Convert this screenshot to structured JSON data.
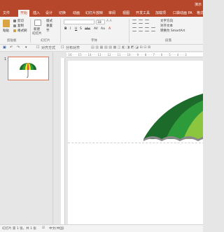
{
  "titlebar": {
    "title": "演示"
  },
  "tabs": [
    {
      "label": "文件"
    },
    {
      "label": "开始"
    },
    {
      "label": "插入"
    },
    {
      "label": "设计"
    },
    {
      "label": "切换"
    },
    {
      "label": "动画"
    },
    {
      "label": "幻灯片放映"
    },
    {
      "label": "审阅"
    },
    {
      "label": "视图"
    },
    {
      "label": "开发工具"
    },
    {
      "label": "加载项"
    },
    {
      "label": "口袋动画 PA"
    },
    {
      "label": "格式"
    }
  ],
  "ribbon": {
    "paste": "粘贴",
    "cut": "剪切",
    "copy": "复制",
    "format_painter": "格式刷",
    "new_slide": "新建",
    "new_slide2": "幻灯片",
    "layout": "版式",
    "reset": "重置",
    "section": "节",
    "font_size": "18",
    "text_direction": "文字方向",
    "align_text": "对齐文本",
    "smartart": "转换为 SmartArt",
    "groups": {
      "clipboard": "剪贴板",
      "slides": "幻灯片",
      "font": "字体",
      "paragraph": "段落"
    }
  },
  "qat": {
    "save": "保存",
    "undo": "撤销",
    "redo": "恢复",
    "align_label": "对齐方式",
    "distribute_label": "分布对齐"
  },
  "ruler": {
    "marks": "· 16 · · · 15 · · · 14 · · · 13 · · · 12 · · · 11 · · · 10 · · · 9 · · · 8 · · · 7 · · · 6 · · · 5 · · · 4 · · · 3"
  },
  "thumbnails": [
    {
      "num": "1"
    }
  ],
  "status": {
    "slide_info": "幻灯片 第 1 张，共 1 张",
    "language": "中文(中国)"
  },
  "colors": {
    "accent": "#b7472a",
    "umbrella_dark": "#1d6b2b",
    "umbrella_mid": "#2e9b3b",
    "umbrella_light": "#8cc63f",
    "umbrella_yellow": "#f5e12c",
    "umbrella_red": "#e53a2a"
  }
}
